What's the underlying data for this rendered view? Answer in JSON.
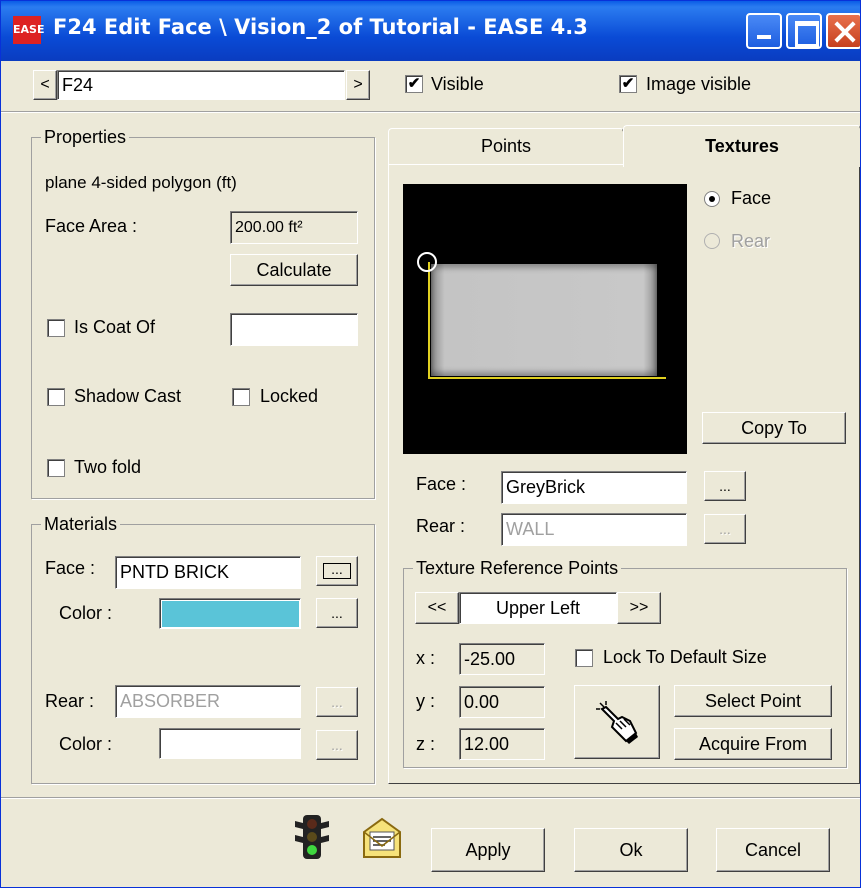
{
  "window": {
    "title": "F24 Edit Face \\ Vision_2 of Tutorial - EASE 4.3",
    "icon_text": "EASE"
  },
  "nav": {
    "prev_label": "<",
    "next_label": ">",
    "face_value": "F24",
    "visible_label": "Visible",
    "visible_checked": true,
    "image_visible_label": "Image visible",
    "image_visible_checked": true
  },
  "properties": {
    "title": "Properties",
    "description": "plane  4-sided polygon  (ft)",
    "face_area_label": "Face Area :",
    "face_area_value": "200.00 ft²",
    "calculate_label": "Calculate",
    "is_coat_of_label": "Is Coat Of",
    "is_coat_of_value": "",
    "shadow_cast_label": "Shadow Cast",
    "locked_label": "Locked",
    "two_fold_label": "Two fold"
  },
  "materials": {
    "title": "Materials",
    "face_label": "Face :",
    "face_value": "PNTD BRICK",
    "face_browse": "...",
    "color_label": "Color :",
    "face_color": "#5ac4d8",
    "color_browse": "...",
    "rear_label": "Rear :",
    "rear_value": "ABSORBER",
    "rear_browse": "...",
    "rear_color_label": "Color :",
    "rear_color_browse": "..."
  },
  "tabs": {
    "points_label": "Points",
    "textures_label": "Textures",
    "active": "Textures"
  },
  "textures": {
    "radio_face_label": "Face",
    "radio_rear_label": "Rear",
    "copy_to_label": "Copy To",
    "face_label": "Face :",
    "face_value": "GreyBrick",
    "face_browse": "...",
    "rear_label": "Rear :",
    "rear_value": "WALL",
    "rear_browse": "...",
    "ref_points": {
      "title": "Texture Reference Points",
      "prev_label": "<<",
      "next_label": ">>",
      "current": "Upper Left",
      "x_label": "x :",
      "x_value": "-25.00",
      "y_label": "y :",
      "y_value": "0.00",
      "z_label": "z :",
      "z_value": "12.00",
      "lock_label": "Lock To Default Size",
      "select_point_label": "Select Point",
      "acquire_from_label": "Acquire From"
    }
  },
  "footer": {
    "apply_label": "Apply",
    "ok_label": "Ok",
    "cancel_label": "Cancel"
  }
}
